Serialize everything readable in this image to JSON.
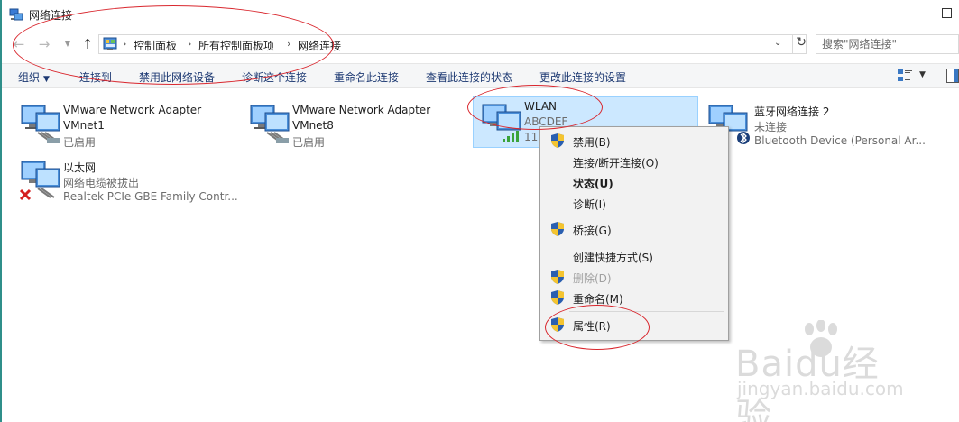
{
  "window": {
    "title": "网络连接",
    "minimize_icon": "minimize-icon",
    "maximize_icon": "maximize-icon"
  },
  "address": {
    "breadcrumbs": [
      "控制面板",
      "所有控制面板项",
      "网络连接"
    ],
    "search_placeholder": "搜索\"网络连接\"",
    "icons": [
      "back-arrow-icon",
      "forward-arrow-icon",
      "history-dropdown-icon",
      "up-arrow-icon",
      "control-panel-icon",
      "chevron-right-icon",
      "refresh-icon"
    ]
  },
  "toolbar": {
    "organize": "组织",
    "items": [
      "连接到",
      "禁用此网络设备",
      "诊断这个连接",
      "重命名此连接",
      "查看此连接的状态",
      "更改此连接的设置"
    ]
  },
  "connections": [
    {
      "name": "VMware Network Adapter",
      "line2": "VMnet1",
      "status": "已启用"
    },
    {
      "name": "VMware Network Adapter",
      "line2": "VMnet8",
      "status": "已启用"
    },
    {
      "name": "WLAN",
      "line2": "ABCDEF",
      "line3": "11b",
      "selected": true
    },
    {
      "name": "蓝牙网络连接 2",
      "line2": "未连接",
      "line3": "Bluetooth Device (Personal Ar..."
    },
    {
      "name": "以太网",
      "line2": "网络电缆被拔出",
      "line3": "Realtek PCIe GBE Family Contr..."
    }
  ],
  "context_menu": {
    "items": [
      {
        "label": "禁用(B)",
        "shield": true
      },
      {
        "label": "连接/断开连接(O)",
        "shield": false
      },
      {
        "label": "状态(U)",
        "shield": false,
        "bold": true
      },
      {
        "label": "诊断(I)",
        "shield": false
      },
      {
        "label": "桥接(G)",
        "shield": true
      },
      {
        "label": "创建快捷方式(S)",
        "shield": false
      },
      {
        "label": "删除(D)",
        "shield": true,
        "disabled": true
      },
      {
        "label": "重命名(M)",
        "shield": true
      },
      {
        "label": "属性(R)",
        "shield": true
      }
    ]
  },
  "watermark": {
    "text": "Baidu经验",
    "url": "jingyan.baidu.com"
  },
  "colors": {
    "accent": "#1e3a73",
    "selection": "#cce8ff",
    "annotation": "#d9272e"
  }
}
